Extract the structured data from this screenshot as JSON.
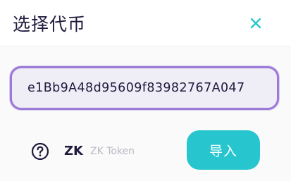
{
  "header": {
    "title": "选择代币",
    "close_icon": "close-icon"
  },
  "address_field": {
    "value": "e1Bb9A48d95609f83982767A047"
  },
  "token": {
    "icon": "question-circle-icon",
    "symbol": "ZK",
    "name": "ZK Token"
  },
  "import_button": {
    "label": "导入"
  },
  "colors": {
    "accent_teal": "#27c6cf",
    "input_border": "#9b7ad8",
    "text_dark": "#1f1a3d",
    "text_muted": "#b9b8c4"
  }
}
